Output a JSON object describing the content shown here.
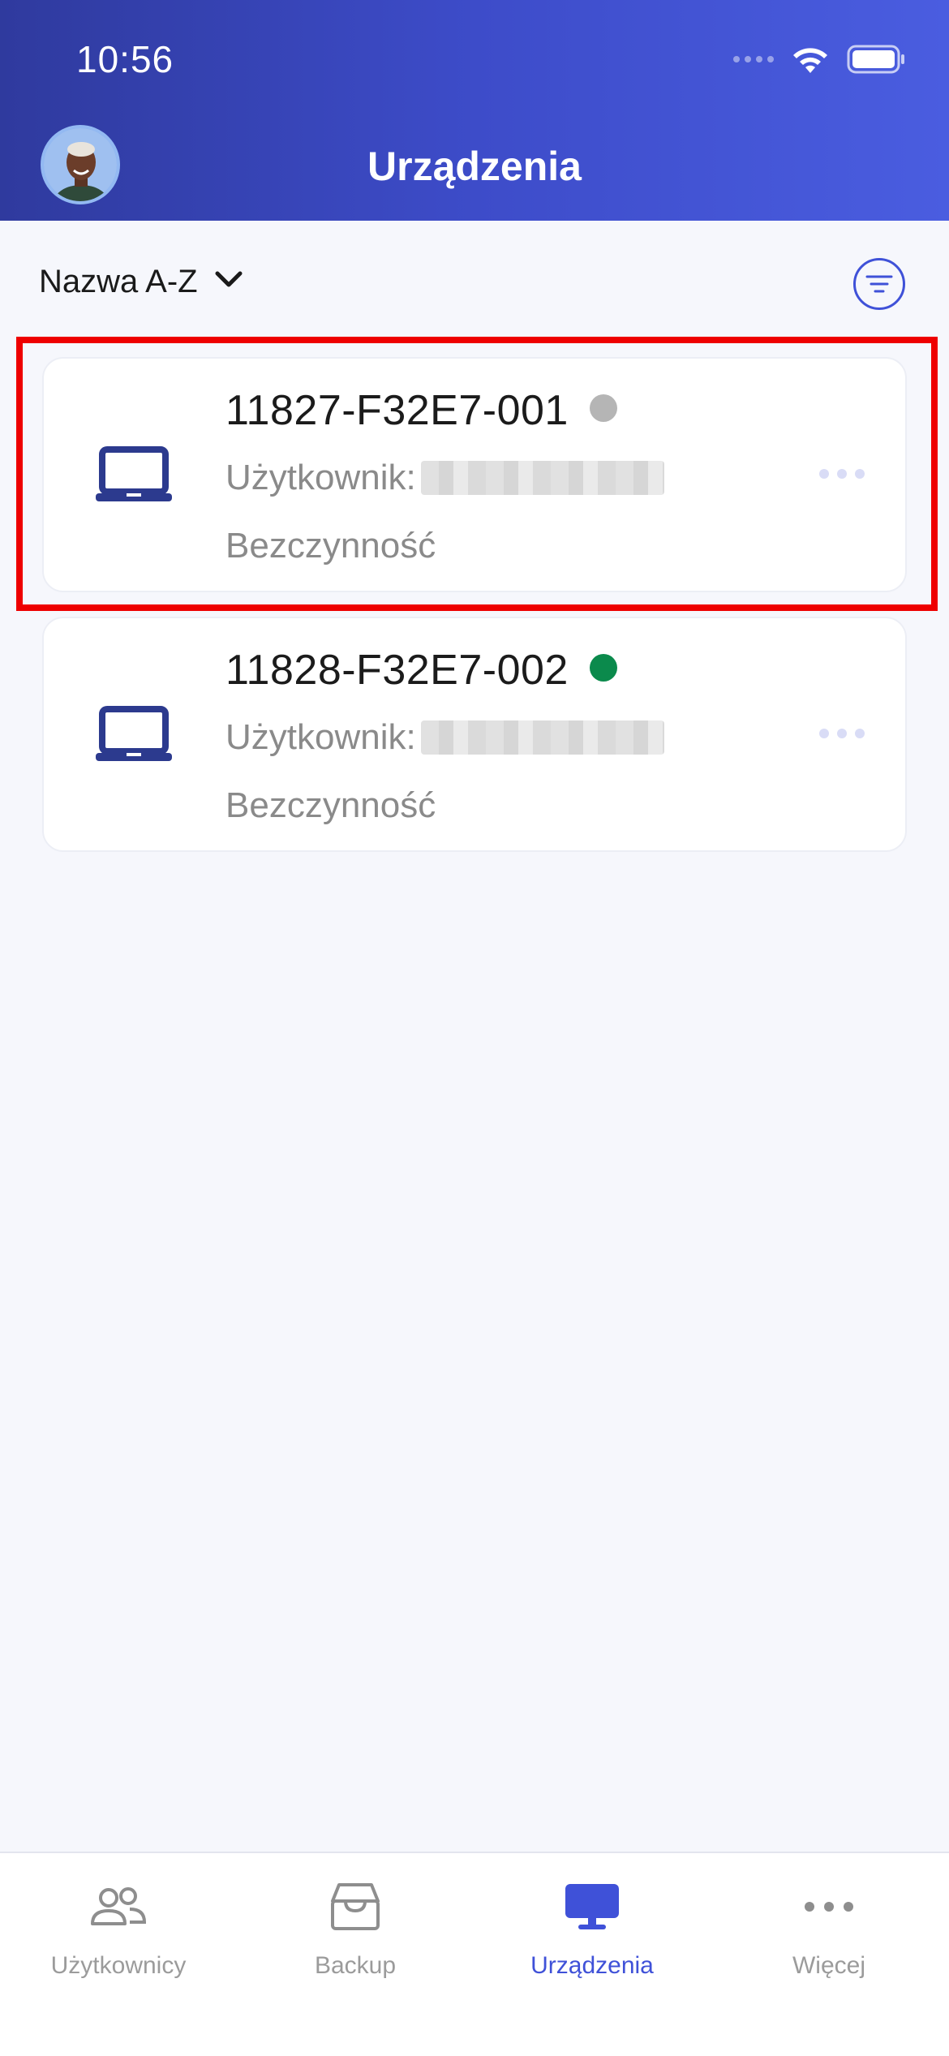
{
  "status_bar": {
    "time": "10:56"
  },
  "header": {
    "title": "Urządzenia"
  },
  "sort": {
    "label": "Nazwa A-Z"
  },
  "devices": [
    {
      "name": "11827-F32E7-001",
      "status_color": "#b5b5b5",
      "user_label": "Użytkownik:",
      "activity": "Bezczynność"
    },
    {
      "name": "11828-F32E7-002",
      "status_color": "#0b8a4c",
      "user_label": "Użytkownik:",
      "activity": "Bezczynność"
    }
  ],
  "tabs": [
    {
      "label": "Użytkownicy",
      "icon": "users-icon"
    },
    {
      "label": "Backup",
      "icon": "archive-box-icon"
    },
    {
      "label": "Urządzenia",
      "icon": "monitor-icon",
      "active": true
    },
    {
      "label": "Więcej",
      "icon": "more-icon"
    }
  ],
  "colors": {
    "accent": "#3f51d8",
    "header_start": "#2f3a9e",
    "header_end": "#4a5de0",
    "highlight": "#ee0000"
  }
}
